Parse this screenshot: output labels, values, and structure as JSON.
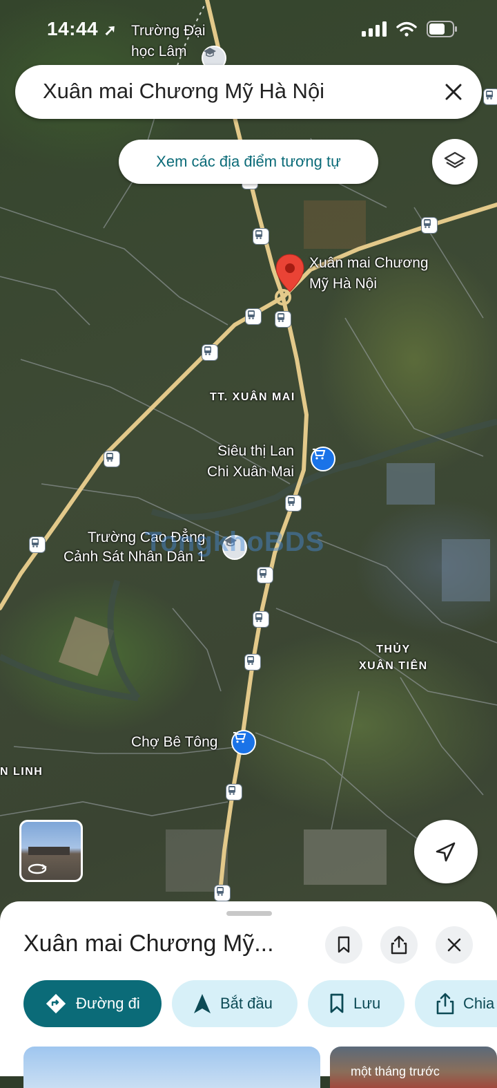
{
  "status_bar": {
    "time": "14:44"
  },
  "search": {
    "query": "Xuân mai Chương Mỹ Hà Nội"
  },
  "similar_places": {
    "label": "Xem các địa điểm tương tự"
  },
  "map": {
    "pin_label_line1": "Xuân mai Chương",
    "pin_label_line2": "Mỹ Hà Nội",
    "school_top_line1": "Trường Đại",
    "school_top_line2": "học Lâm",
    "area_xuan_mai": "TT. XUÂN MAI",
    "supermarket_line1": "Siêu thị Lan",
    "supermarket_line2": "Chi Xuân Mai",
    "college_line1": "Trường Cao Đẳng",
    "college_line2": "Cảnh Sát Nhân Dân 1",
    "area_thuy_line1": "THỦY",
    "area_thuy_line2": "XUÂN TIÊN",
    "market": "Chợ Bê Tông",
    "area_linh": "N LINH",
    "watermark": "TongkhoBDS",
    "colors": {
      "road": "#e3c98a",
      "pin": "#ea4335",
      "poi_shop": "#1a73e8"
    }
  },
  "sheet": {
    "title": "Xuân mai Chương Mỹ...",
    "actions": [
      {
        "label": "Đường đi",
        "icon": "directions-icon"
      },
      {
        "label": "Bắt đầu",
        "icon": "navigation-icon"
      },
      {
        "label": "Lưu",
        "icon": "bookmark-icon"
      },
      {
        "label": "Chia",
        "icon": "share-icon"
      }
    ],
    "photo_caption": "một tháng trước"
  },
  "accent": "#0b6b78"
}
